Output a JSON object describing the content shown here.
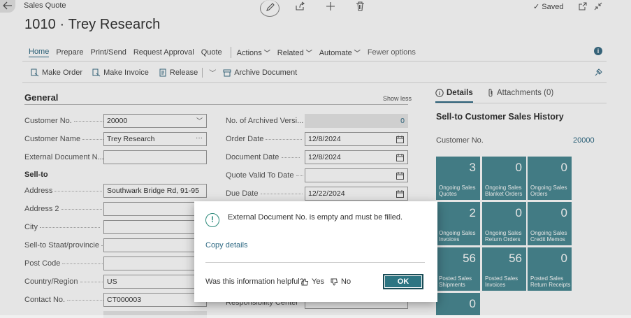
{
  "header": {
    "breadcrumb": "Sales Quote",
    "saved_label": "Saved",
    "title": "1010 · Trey Research"
  },
  "action_bar": {
    "tabs": [
      "Home",
      "Prepare",
      "Print/Send",
      "Request Approval",
      "Quote"
    ],
    "menus": [
      "Actions",
      "Related",
      "Automate"
    ],
    "fewer": "Fewer options"
  },
  "toolbar": {
    "make_order": "Make Order",
    "make_invoice": "Make Invoice",
    "release": "Release",
    "archive": "Archive Document"
  },
  "general": {
    "title": "General",
    "show_less": "Show less",
    "customer_no_label": "Customer No.",
    "customer_no_value": "20000",
    "customer_name_label": "Customer Name",
    "customer_name_value": "Trey Research",
    "ext_doc_label": "External Document N...",
    "ext_doc_value": "",
    "sell_to_header": "Sell-to",
    "address_label": "Address",
    "address_value": "Southwark Bridge Rd, 91-95",
    "address2_label": "Address 2",
    "city_label": "City",
    "state_label": "Sell-to Staat/provincie",
    "post_code_label": "Post Code",
    "country_label": "Country/Region",
    "country_value": "US",
    "contact_label": "Contact No.",
    "contact_value": "CT000003",
    "archived_label": "No. of Archived Versi...",
    "archived_value": "0",
    "order_date_label": "Order Date",
    "order_date_value": "12/8/2024",
    "document_date_label": "Document Date",
    "document_date_value": "12/8/2024",
    "quote_valid_label": "Quote Valid To Date",
    "quote_valid_value": "",
    "due_date_label": "Due Date",
    "due_date_value": "12/22/2024",
    "responsibility_label": "Responsibility Center"
  },
  "factbox": {
    "details_tab": "Details",
    "attachments_tab": "Attachments (0)",
    "history_title": "Sell-to Customer Sales History",
    "customer_no_label": "Customer No.",
    "customer_no_value": "20000",
    "tiles": [
      {
        "value": "3",
        "caption": "Ongoing Sales Quotes"
      },
      {
        "value": "0",
        "caption": "Ongoing Sales Blanket Orders"
      },
      {
        "value": "0",
        "caption": "Ongoing Sales Orders"
      },
      {
        "value": "2",
        "caption": "Ongoing Sales Invoices"
      },
      {
        "value": "0",
        "caption": "Ongoing Sales Return Orders"
      },
      {
        "value": "0",
        "caption": "Ongoing Sales Credit Memos"
      },
      {
        "value": "56",
        "caption": "Posted Sales Shipments"
      },
      {
        "value": "56",
        "caption": "Posted Sales Invoices"
      },
      {
        "value": "0",
        "caption": "Posted Sales Return Receipts"
      },
      {
        "value": "0",
        "caption": ""
      }
    ]
  },
  "dialog": {
    "message": "External Document No. is empty and must be filled.",
    "copy_details": "Copy details",
    "helpful_question": "Was this information helpful?",
    "yes": "Yes",
    "no": "No",
    "ok": "OK"
  }
}
